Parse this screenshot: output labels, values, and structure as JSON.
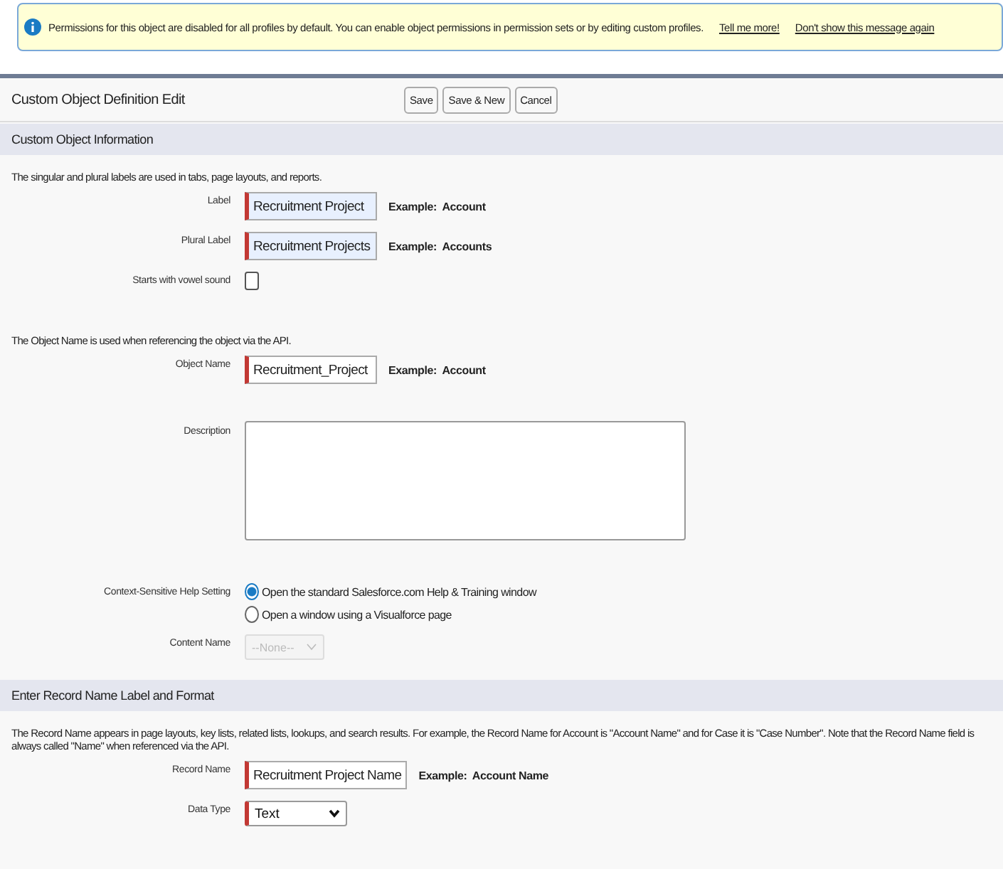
{
  "banner": {
    "message": "Permissions for this object are disabled for all profiles by default. You can enable object permissions in permission sets or by editing custom profiles.",
    "links": [
      "Tell me more!",
      "Don't show this message again"
    ]
  },
  "page": {
    "title": "Custom Object Definition Edit",
    "buttons": [
      "Save",
      "Save & New",
      "Cancel"
    ]
  },
  "sections": [
    {
      "title": "Custom Object Information",
      "items": [
        {
          "kind": "note",
          "text": "The singular and plural labels are used in tabs, page layouts, and reports."
        },
        {
          "kind": "text",
          "label": "Label",
          "value": "Recruitment Project",
          "required": true,
          "autofilled": true,
          "example": "Example:  Account"
        },
        {
          "kind": "text",
          "label": "Plural Label",
          "value": "Recruitment Projects",
          "required": true,
          "autofilled": true,
          "example": "Example:  Accounts"
        },
        {
          "kind": "checkbox",
          "label": "Starts with vowel sound",
          "checked": false
        },
        {
          "kind": "note",
          "text": "The Object Name is used when referencing the object via the API."
        },
        {
          "kind": "text",
          "label": "Object Name",
          "value": "Recruitment_Project",
          "required": true,
          "autofilled": false,
          "example": "Example:  Account"
        },
        {
          "kind": "textarea",
          "label": "Description"
        },
        {
          "kind": "radio",
          "label": "Context-Sensitive Help Setting",
          "options": [
            {
              "text": "Open the standard Salesforce.com Help & Training window",
              "selected": true
            },
            {
              "text": "Open a window using a Visualforce page",
              "selected": false
            }
          ]
        },
        {
          "kind": "select",
          "label": "Content Name",
          "value": "--None--",
          "required": false,
          "disabled": true
        }
      ]
    },
    {
      "title": "Enter Record Name Label and Format",
      "items": [
        {
          "kind": "note",
          "text": "The Record Name appears in page layouts, key lists, related lists, lookups, and search results. For example, the Record Name for Account is \"Account Name\" and for Case it is \"Case Number\". Note that the Record Name field is always called \"Name\" when referenced via the API."
        },
        {
          "kind": "text",
          "label": "Record Name",
          "value": "Recruitment Project Name",
          "required": true,
          "autofilled": false,
          "example": "Example:  Account Name"
        },
        {
          "kind": "select",
          "label": "Data Type",
          "value": "Text",
          "required": true,
          "disabled": false
        }
      ]
    }
  ]
}
